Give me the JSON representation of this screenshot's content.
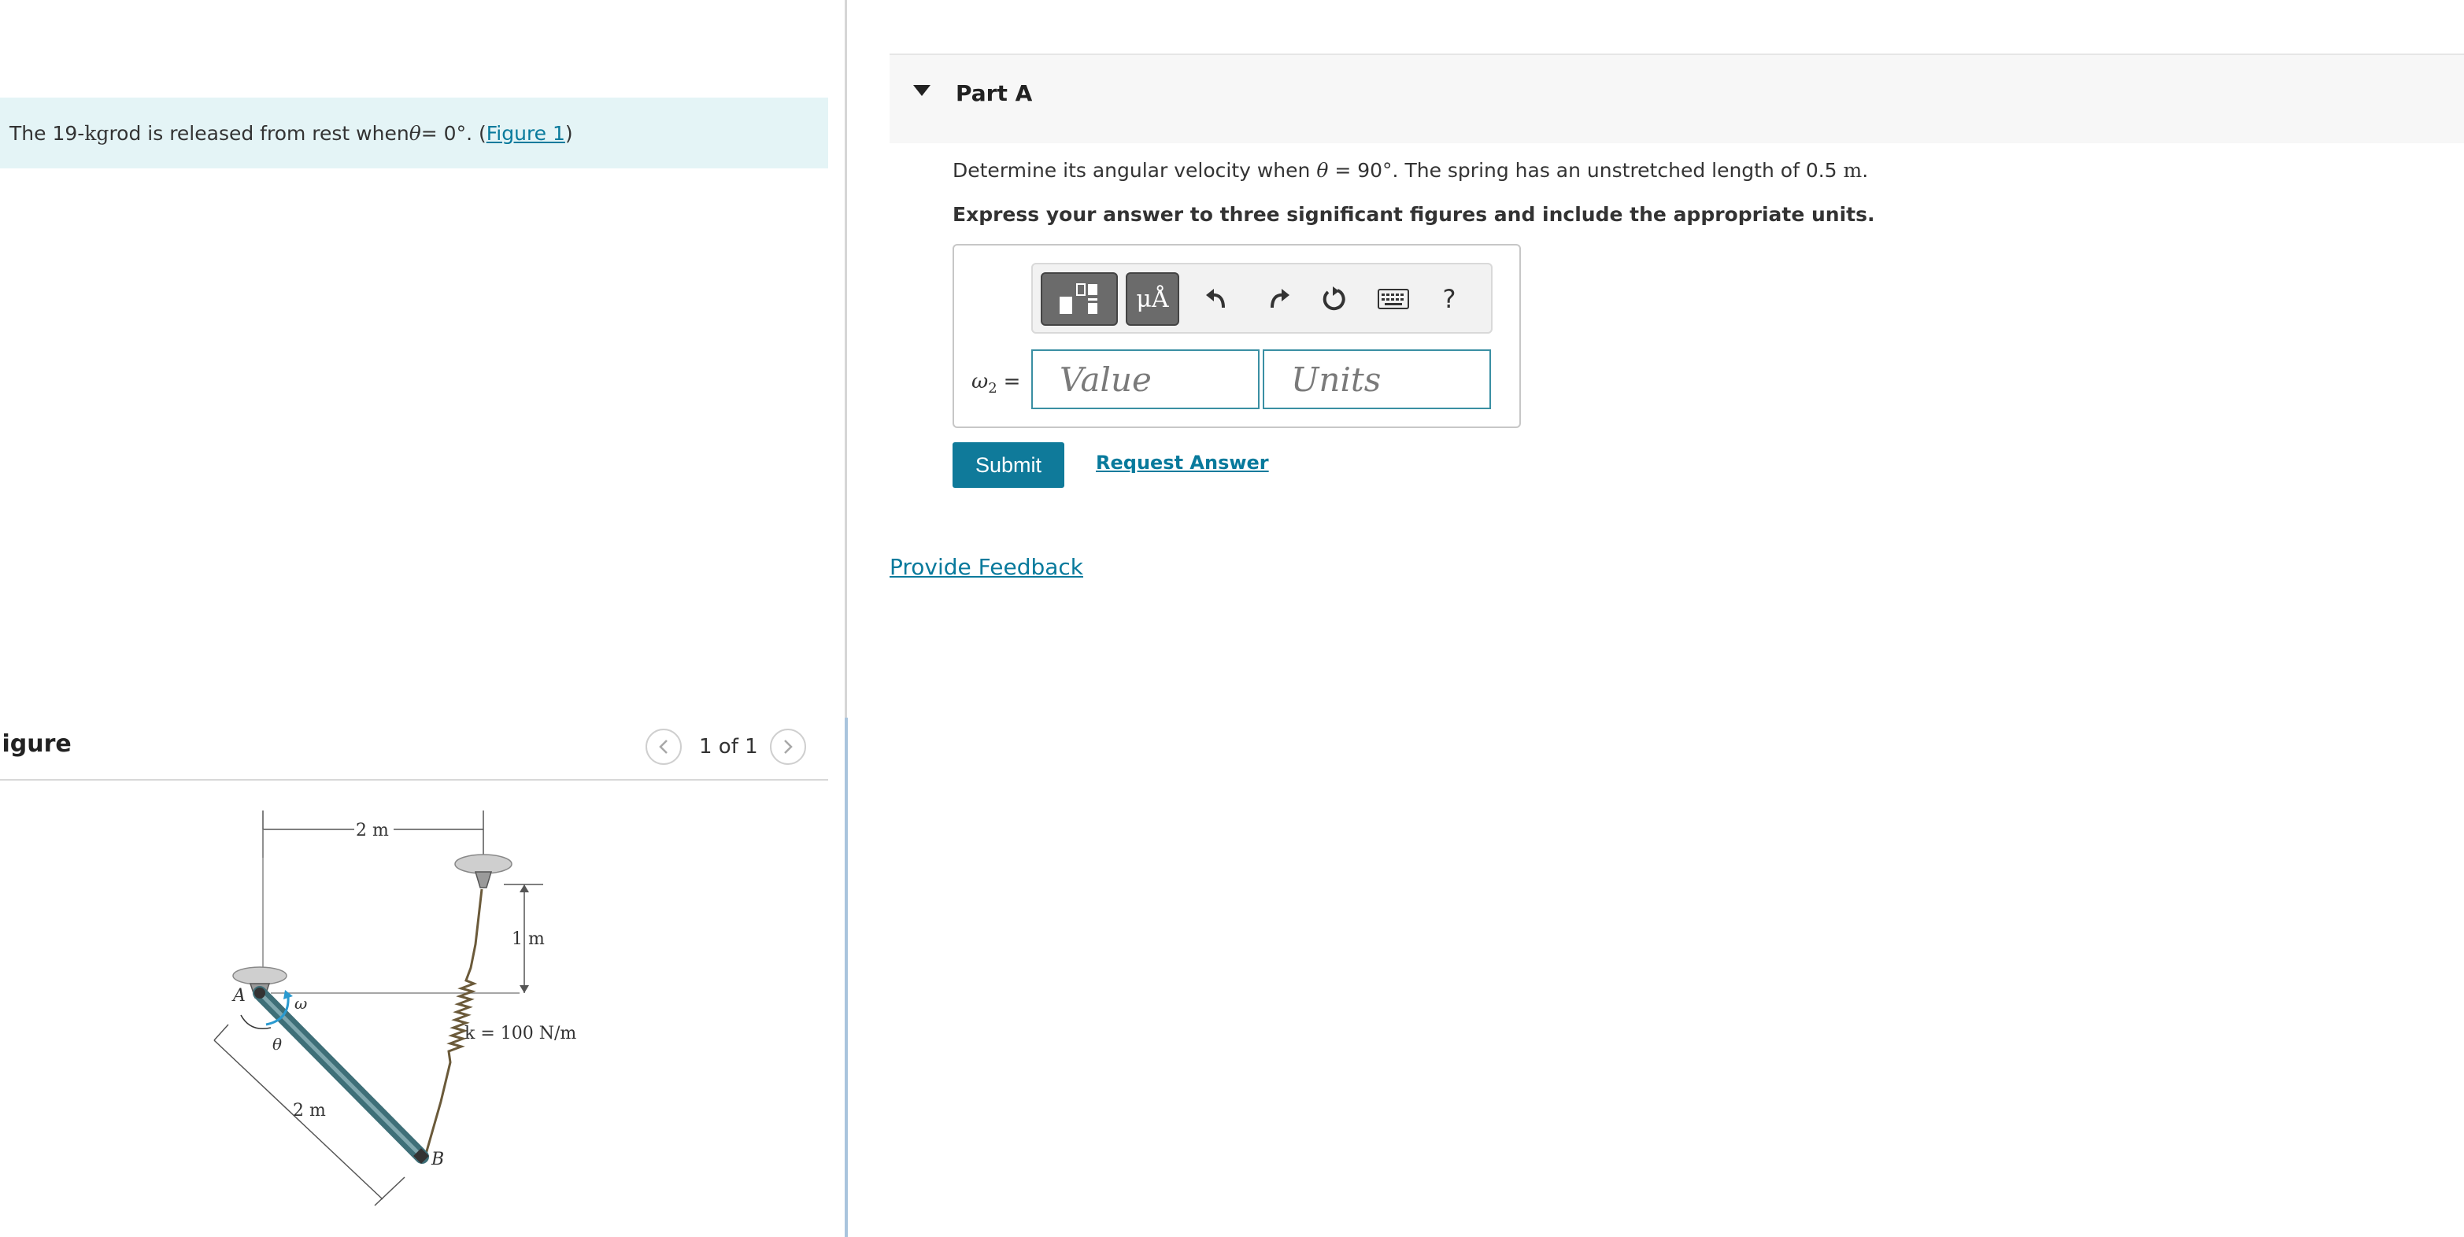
{
  "problem": {
    "pre": "The 19-",
    "mass_unit": "kg",
    "mid": " rod is released from rest when ",
    "theta": "θ",
    "eq": " = 0°. (",
    "figure_link": "Figure 1",
    "post": ")"
  },
  "figure_panel": {
    "title": "Figure",
    "count": "1 of 1",
    "prev_icon": "chevron-left-icon",
    "next_icon": "chevron-right-icon",
    "labels": {
      "top_width": "2 m",
      "vertical": "1 m",
      "spring": "k = 100 N/m",
      "rod_length": "2 m",
      "point_a": "A",
      "point_b": "B",
      "omega": "ω",
      "theta": "θ"
    }
  },
  "part": {
    "title": "Part A",
    "question_pre": "Determine its angular velocity when ",
    "question_theta": "θ",
    "question_eq": " = 90°. The spring has an unstretched length of 0.5 ",
    "question_unit": "m",
    "question_post": ".",
    "instruction": "Express your answer to three significant figures and include the appropriate units."
  },
  "answer": {
    "symbol": "ω",
    "subscript": "2",
    "equals": "=",
    "value_placeholder": "Value",
    "units_placeholder": "Units",
    "units_button_label": "μÅ",
    "help_label": "?"
  },
  "toolbar_icons": [
    "templates-icon",
    "units-icon",
    "undo-icon",
    "redo-icon",
    "reset-icon",
    "keyboard-icon",
    "help-icon"
  ],
  "actions": {
    "submit": "Submit",
    "request_answer": "Request Answer",
    "provide_feedback": "Provide Feedback"
  }
}
